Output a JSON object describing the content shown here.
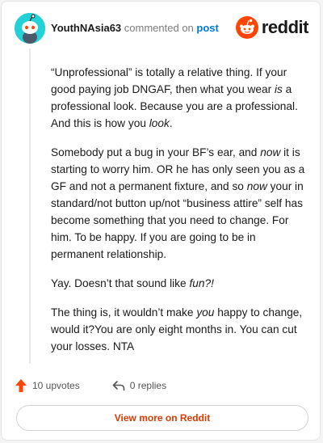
{
  "comment": {
    "author": "YouthNAsia63",
    "action": "commented on",
    "post_link": "post",
    "logo_text": "reddit",
    "paragraphs": [
      [
        {
          "t": "“Unprofessional” is totally a relative thing. If your good paying job DNGAF, then what you wear "
        },
        {
          "t": "is",
          "i": true
        },
        {
          "t": " a professional look. Because you are a professional. And this is how you "
        },
        {
          "t": "look",
          "i": true
        },
        {
          "t": "."
        }
      ],
      [
        {
          "t": "Somebody put a bug in your BF’s ear, and "
        },
        {
          "t": "now",
          "i": true
        },
        {
          "t": " it is starting to worry him. OR he has only seen you as a GF and not a permanent fixture, and so "
        },
        {
          "t": "now",
          "i": true
        },
        {
          "t": " your in standard/not button up/not “business attire” self has become something that you need to change. For him. To be happy. If you are going to be in permanent relationship."
        }
      ],
      [
        {
          "t": "Yay. Doesn’t that sound like "
        },
        {
          "t": "fun?!",
          "i": true
        }
      ],
      [
        {
          "t": "The thing is, it wouldn’t make "
        },
        {
          "t": "you",
          "i": true
        },
        {
          "t": " happy to change, would it?You are only eight months in. You can cut your losses. NTA"
        }
      ]
    ],
    "upvotes": "10 upvotes",
    "replies": "0 replies",
    "view_more": "View more on Reddit"
  },
  "icons": {
    "avatar": "snoo-avatar",
    "logo": "reddit-snoo-logo-icon",
    "upvote": "upvote-arrow-icon",
    "reply": "reply-arrow-icon"
  },
  "colors": {
    "avatar_bg": "#24d1d6",
    "reddit_orange": "#ff4500",
    "link_blue": "#0079d3",
    "view_more_text": "#d93a00",
    "upvote_arrow": "#ff4500"
  }
}
